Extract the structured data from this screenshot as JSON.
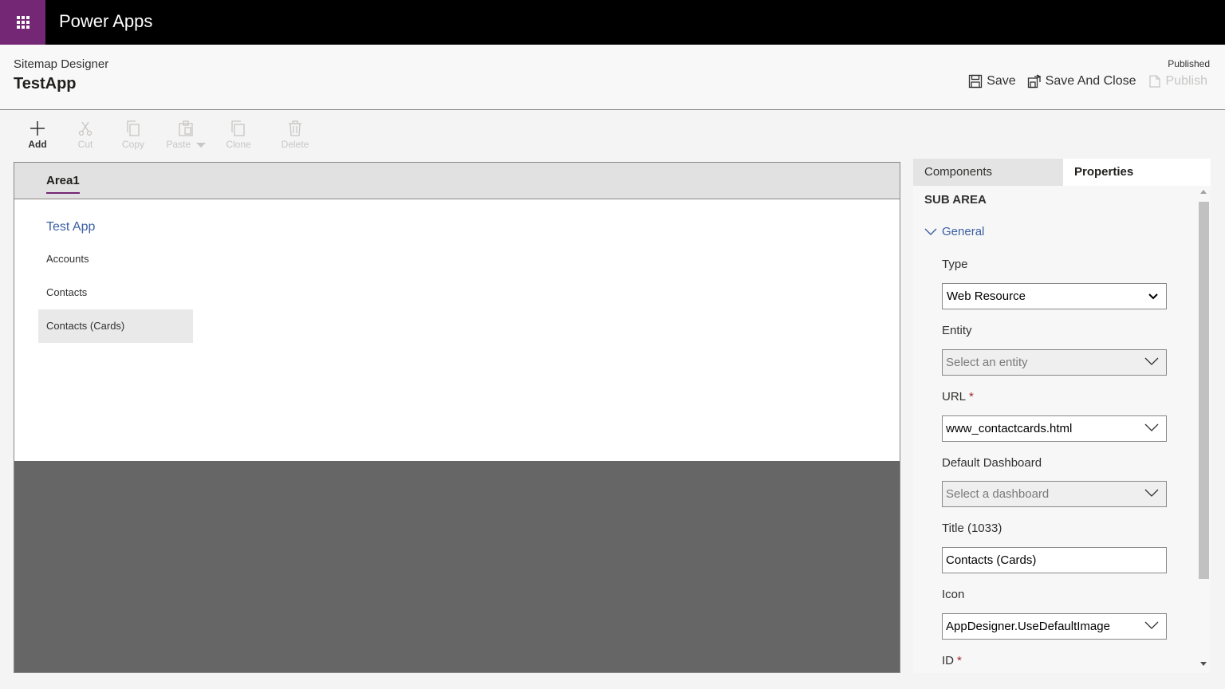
{
  "topbar": {
    "app_name": "Power Apps"
  },
  "header": {
    "designer_label": "Sitemap Designer",
    "app_title": "TestApp",
    "status": "Published",
    "save_label": "Save",
    "save_close_label": "Save And Close",
    "publish_label": "Publish"
  },
  "commands": {
    "add": "Add",
    "cut": "Cut",
    "copy": "Copy",
    "paste": "Paste",
    "clone": "Clone",
    "delete": "Delete"
  },
  "canvas": {
    "area_tab": "Area1",
    "group_title": "Test App",
    "subareas": [
      "Accounts",
      "Contacts",
      "Contacts (Cards)"
    ]
  },
  "panel": {
    "tab_components": "Components",
    "tab_properties": "Properties",
    "section_title": "SUB AREA",
    "general_label": "General",
    "type_label": "Type",
    "type_value": "Web Resource",
    "entity_label": "Entity",
    "entity_placeholder": "Select an entity",
    "url_label": "URL",
    "url_value": "www_contactcards.html",
    "dashboard_label": "Default Dashboard",
    "dashboard_placeholder": "Select a dashboard",
    "title_label": "Title (1033)",
    "title_value": "Contacts (Cards)",
    "icon_label": "Icon",
    "icon_value": "AppDesigner.UseDefaultImage",
    "id_label": "ID",
    "required_mark": "*"
  },
  "colors": {
    "accent_purple": "#742774",
    "link_blue": "#3b5fa3",
    "required_red": "#a4262c"
  }
}
